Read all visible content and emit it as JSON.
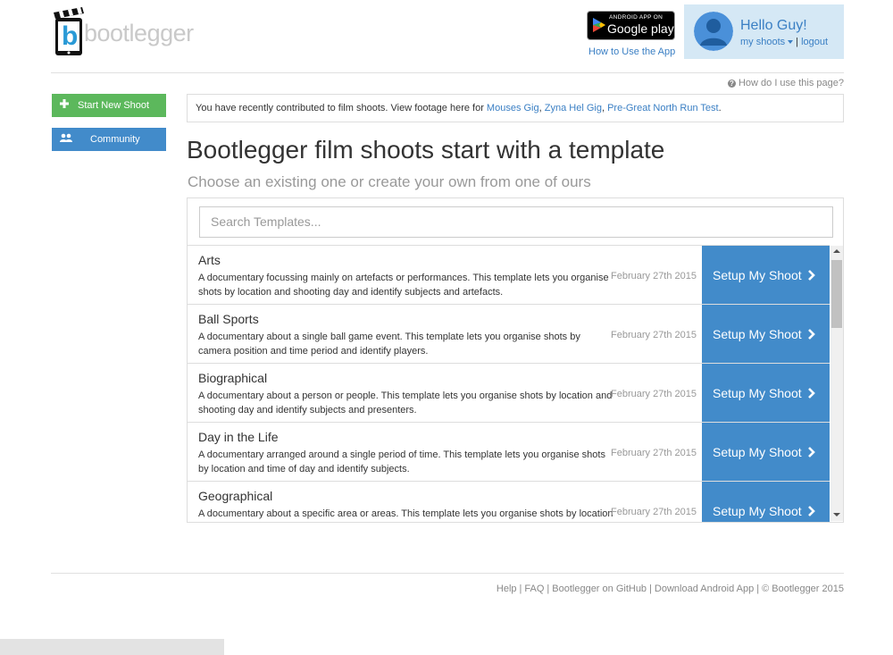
{
  "brand": {
    "logo_text": "bootlegger",
    "logo_letter": "b"
  },
  "header": {
    "gplay_small": "ANDROID APP ON",
    "gplay_big": "Google play",
    "how_to_label": "How to Use the App",
    "greeting": "Hello Guy!",
    "my_shoots_label": "my shoots",
    "logout_label": "logout"
  },
  "sidebar": {
    "start_new_shoot": "Start New Shoot",
    "community": "Community"
  },
  "main": {
    "help_link": "How do I use this page?",
    "notice": {
      "prefix": "You have recently contributed to film shoots. View footage here for ",
      "links": [
        "Mouses Gig",
        "Zyna Hel Gig",
        "Pre-Great North Run Test"
      ],
      "sep": ", ",
      "suffix": "."
    },
    "title": "Bootlegger film shoots start with a template",
    "subtitle": "Choose an existing one or create your own from one of ours",
    "search_placeholder": "Search Templates...",
    "setup_label": "Setup My Shoot",
    "templates": [
      {
        "name": "Arts",
        "description": "A documentary focussing mainly on artefacts or performances. This template lets you organise shots by location and shooting day and identify subjects and artefacts.",
        "date": "February 27th 2015"
      },
      {
        "name": "Ball Sports",
        "description": "A documentary about a single ball game event. This template lets you organise shots by camera position and time period and identify players.",
        "date": "February 27th 2015"
      },
      {
        "name": "Biographical",
        "description": "A documentary about a person or people. This template lets you organise shots by location and shooting day and identify subjects and presenters.",
        "date": "February 27th 2015"
      },
      {
        "name": "Day in the Life",
        "description": "A documentary arranged around a single period of time. This template lets you organise shots by location and time of day and identify subjects.",
        "date": "February 27th 2015"
      },
      {
        "name": "Geographical",
        "description": "A documentary about a specific area or areas. This template lets you organise shots by location",
        "date": "February 27th 2015"
      }
    ]
  },
  "footer": {
    "links": [
      "Help",
      "FAQ",
      "Bootlegger on GitHub",
      "Download Android App"
    ],
    "copyright": "© Bootlegger 2015",
    "separator": "|"
  },
  "colors": {
    "accent": "#428bca",
    "green": "#5cb85c",
    "user_box": "#d5e8f5"
  },
  "icons": [
    "clapperboard-phone-logo-icon",
    "play-store-icon",
    "user-avatar-icon",
    "plus-icon",
    "users-icon",
    "question-circle-icon",
    "chevron-right-icon"
  ]
}
